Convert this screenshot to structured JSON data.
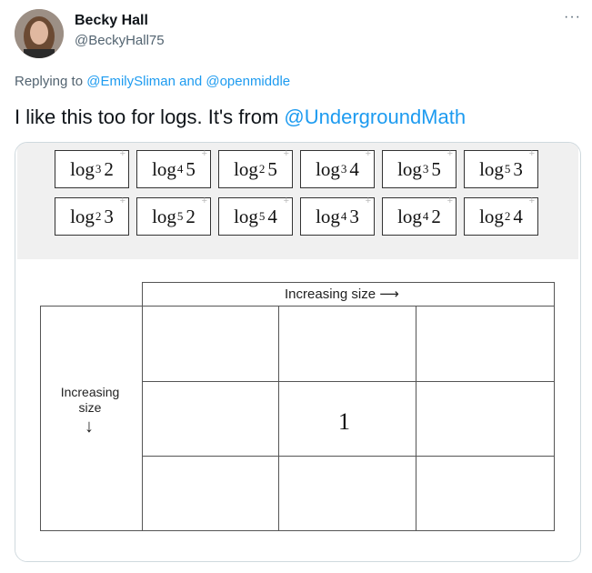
{
  "tweet": {
    "author_name": "Becky Hall",
    "author_handle": "@BeckyHall75",
    "more_icon": "···",
    "replying_prefix": "Replying to",
    "reply_user1": "@EmilySliman",
    "reply_and": "and",
    "reply_user2": "@openmiddle",
    "text_before": "I like this too for logs. It's from",
    "text_link": "@UndergroundMath"
  },
  "cards": [
    {
      "base": "3",
      "arg": "2"
    },
    {
      "base": "4",
      "arg": "5"
    },
    {
      "base": "2",
      "arg": "5"
    },
    {
      "base": "3",
      "arg": "4"
    },
    {
      "base": "3",
      "arg": "5"
    },
    {
      "base": "5",
      "arg": "3"
    },
    {
      "base": "2",
      "arg": "3"
    },
    {
      "base": "5",
      "arg": "2"
    },
    {
      "base": "5",
      "arg": "4"
    },
    {
      "base": "4",
      "arg": "3"
    },
    {
      "base": "4",
      "arg": "2"
    },
    {
      "base": "2",
      "arg": "4"
    }
  ],
  "card_prefix": "log",
  "card_plus": "+",
  "grid": {
    "top_label": "Increasing size ⟶",
    "side_label_line1": "Increasing",
    "side_label_line2": "size",
    "side_arrow": "↓",
    "center_value": "1"
  }
}
